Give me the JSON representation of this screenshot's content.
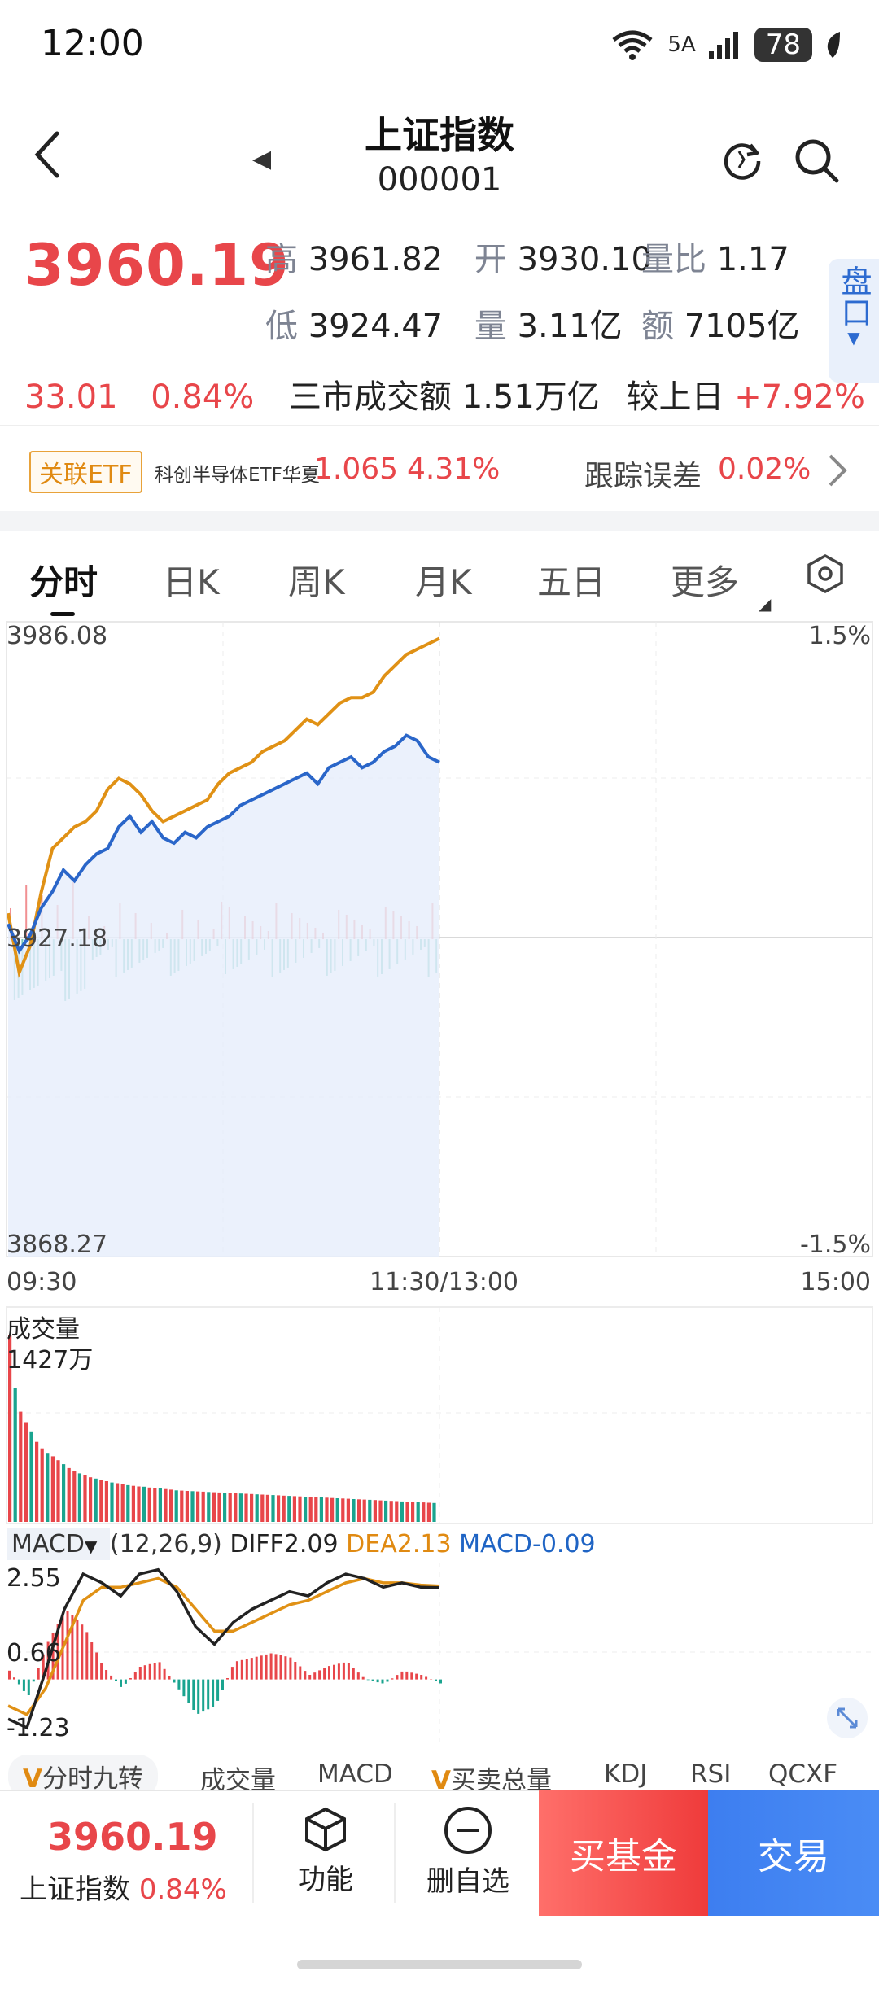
{
  "status_bar": {
    "time": "12:00",
    "net_label": "5A",
    "wifi_label": "6",
    "battery": "78"
  },
  "header": {
    "title": "上证指数",
    "code": "000001",
    "prev_icon": "triangle-left"
  },
  "quote": {
    "price": "3960.19",
    "change": "33.01",
    "change_pct": "0.84%",
    "high_label": "高",
    "high": "3961.82",
    "open_label": "开",
    "open": "3930.10",
    "vol_ratio_label": "量比",
    "vol_ratio": "1.17",
    "low_label": "低",
    "low": "3924.47",
    "volume_label": "量",
    "volume": "3.11亿",
    "amount_label": "额",
    "amount": "7105亿",
    "market_turnover": "三市成交额 1.51万亿",
    "vs_prev_label": "较上日",
    "vs_prev": "+7.92%",
    "pankou": "盘口"
  },
  "etf": {
    "badge": "关联ETF",
    "name": "科创半导体ETF华夏",
    "price": "1.065",
    "pct": "4.31%",
    "tracking_label": "跟踪误差",
    "tracking": "0.02%"
  },
  "tabs": [
    "分时",
    "日K",
    "周K",
    "月K",
    "五日",
    "更多"
  ],
  "chart_labels": {
    "y_top": "3986.08",
    "y_mid": "3927.18",
    "y_bottom": "3868.27",
    "pct_top": "1.5%",
    "pct_bottom": "-1.5%",
    "x_start": "09:30",
    "x_mid": "11:30/13:00",
    "x_end": "15:00"
  },
  "volume_panel": {
    "title": "成交量",
    "max_label": "1427万"
  },
  "macd_panel": {
    "name": "MACD",
    "params": "(12,26,9)",
    "diff": "DIFF2.09",
    "dea": "DEA2.13",
    "macd": "MACD-0.09",
    "y_top": "2.55",
    "y_mid": "0.66",
    "y_bottom": "-1.23"
  },
  "indicator_tabs": [
    "分时九转",
    "成交量",
    "MACD",
    "买卖总量",
    "KDJ",
    "RSI",
    "QCXF"
  ],
  "bottom_bar": {
    "price": "3960.19",
    "name": "上证指数",
    "pct": "0.84%",
    "func_label": "功能",
    "remove_label": "删自选",
    "buy_fund_label": "买基金",
    "trade_label": "交易"
  },
  "colors": {
    "up": "#e8464a",
    "down": "#1aa48f",
    "price_line": "#2a66c9",
    "avg_line": "#e09115",
    "buy": "#ef3b3b",
    "trade": "#3d7ef0"
  },
  "chart_data": [
    {
      "type": "line",
      "title": "分时",
      "xlim": [
        "09:30",
        "15:00"
      ],
      "ylim": [
        3868.27,
        3986.08
      ],
      "prev_close": 3927.18,
      "x": [
        "09:30",
        "09:33",
        "09:36",
        "09:39",
        "09:42",
        "09:45",
        "09:50",
        "09:55",
        "10:00",
        "10:05",
        "10:10",
        "10:15",
        "10:20",
        "10:25",
        "10:30",
        "10:35",
        "10:40",
        "10:45",
        "10:50",
        "10:55",
        "11:00",
        "11:05",
        "11:10",
        "11:15",
        "11:20",
        "11:25",
        "11:30",
        "13:00",
        "13:05",
        "13:10",
        "13:15",
        "13:20",
        "13:25",
        "13:30",
        "13:35",
        "13:40",
        "13:45",
        "13:50",
        "13:55",
        "14:00"
      ],
      "series": [
        {
          "values": [
            3930,
            3925,
            3928,
            3933,
            3936,
            3940,
            3938,
            3941,
            3943,
            3944,
            3948,
            3950,
            3947,
            3949,
            3946,
            3945,
            3947,
            3946,
            3948,
            3949,
            3950,
            3952,
            3953,
            3954,
            3955,
            3956,
            3957,
            3958,
            3956,
            3959,
            3960,
            3961,
            3959,
            3960,
            3962,
            3963,
            3965,
            3964,
            3961,
            3960
          ]
        },
        {
          "values": [
            3932,
            3921,
            3926,
            3936,
            3944,
            3946,
            3948,
            3949,
            3951,
            3955,
            3957,
            3956,
            3954,
            3951,
            3949,
            3950,
            3951,
            3952,
            3953,
            3956,
            3958,
            3959,
            3960,
            3962,
            3963,
            3964,
            3966,
            3968,
            3967,
            3969,
            3971,
            3972,
            3972,
            3973,
            3976,
            3978,
            3980,
            3981,
            3982,
            3983
          ]
        }
      ]
    },
    {
      "type": "bar",
      "title": "成交量",
      "max": "1427万",
      "values": [
        1427,
        1020,
        840,
        760,
        690,
        610,
        560,
        520,
        500,
        470,
        440,
        410,
        390,
        370,
        360,
        340,
        330,
        320,
        310,
        300,
        295,
        290,
        280,
        275,
        270,
        268,
        262,
        258,
        255,
        250,
        246,
        240,
        238,
        236,
        234,
        232,
        230,
        228,
        226,
        224,
        222,
        220,
        218,
        216,
        214,
        212,
        210,
        208,
        206,
        204,
        202,
        200,
        198,
        196,
        194,
        192,
        190,
        188,
        186,
        184,
        182,
        180,
        178,
        176,
        174,
        172,
        170,
        168,
        166,
        164,
        162,
        160,
        158,
        156,
        154,
        152,
        150,
        148,
        146,
        144
      ]
    },
    {
      "type": "line",
      "title": "MACD",
      "ylim": [
        -1.23,
        2.55
      ],
      "series": [
        {
          "name": "DIFF",
          "values": [
            -0.9,
            -1.1,
            0.2,
            1.6,
            2.4,
            2.2,
            1.9,
            2.4,
            2.5,
            2.0,
            1.2,
            0.8,
            1.3,
            1.6,
            1.8,
            2.0,
            1.9,
            2.2,
            2.4,
            2.3,
            2.1,
            2.2,
            2.1,
            2.09
          ]
        },
        {
          "name": "DEA",
          "values": [
            -0.6,
            -0.8,
            -0.2,
            0.8,
            1.8,
            2.1,
            2.1,
            2.2,
            2.3,
            2.1,
            1.6,
            1.1,
            1.1,
            1.3,
            1.5,
            1.7,
            1.8,
            2.0,
            2.2,
            2.3,
            2.2,
            2.2,
            2.15,
            2.13
          ]
        }
      ],
      "hist": [
        0.2,
        -0.4,
        0.8,
        1.6,
        1.2,
        0.3,
        -0.2,
        0.3,
        0.4,
        -0.2,
        -0.8,
        -0.6,
        0.4,
        0.5,
        0.6,
        0.5,
        0.1,
        0.3,
        0.4,
        0.0,
        -0.1,
        0.2,
        0.1,
        -0.09
      ]
    }
  ]
}
